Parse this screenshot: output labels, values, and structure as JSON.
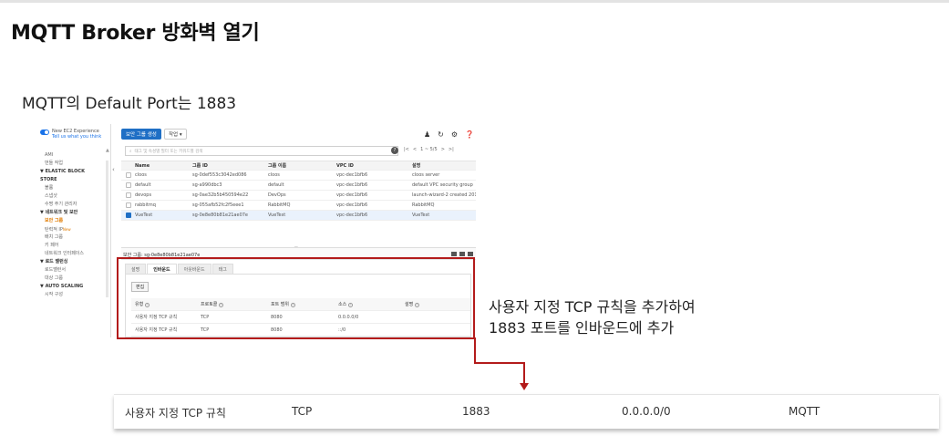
{
  "slide": {
    "title": "MQTT Broker 방화벽 열기",
    "subtitle": "MQTT의 Default Port는 1883",
    "note_line1": "사용자 지정 TCP 규칙을 추가하여",
    "note_line2": "1883 포트를 인바운드에 추가"
  },
  "console": {
    "new_experience": "New EC2 Experience",
    "tell_us": "Tell us what you think",
    "sidebar": [
      {
        "label": "AMI",
        "type": "item"
      },
      {
        "label": "번들 작업",
        "type": "item"
      },
      {
        "label": "▼ ELASTIC BLOCK",
        "type": "header"
      },
      {
        "label": "STORE",
        "type": "header"
      },
      {
        "label": "볼륨",
        "type": "item"
      },
      {
        "label": "스냅샷",
        "type": "item"
      },
      {
        "label": "수명 주기 관리자",
        "type": "item"
      },
      {
        "label": "▼ 네트워크 및 보안",
        "type": "header"
      },
      {
        "label": "보안 그룹",
        "type": "active"
      },
      {
        "label": "탄력적 IP",
        "type": "item",
        "badge": "New"
      },
      {
        "label": "배치 그룹",
        "type": "item"
      },
      {
        "label": "키 페어",
        "type": "item"
      },
      {
        "label": "네트워크 인터페이스",
        "type": "item"
      },
      {
        "label": "▼ 로드 밸런싱",
        "type": "header"
      },
      {
        "label": "로드밸런서",
        "type": "item"
      },
      {
        "label": "대상 그룹",
        "type": "item"
      },
      {
        "label": "▼ AUTO SCALING",
        "type": "header"
      },
      {
        "label": "시작 구성",
        "type": "item"
      }
    ],
    "create_button": "보안 그룹 생성",
    "actions_button": "작업 ▾",
    "search_placeholder": "태그 및 속성별 필터 또는 키워드별 검색",
    "pagination": "1 ~ 5/5",
    "columns": [
      "Name",
      "그룹 ID",
      "그룹 이름",
      "VPC ID",
      "설명"
    ],
    "rows": [
      {
        "name": "cloos",
        "group_id": "sg-0def553c3042ed086",
        "group_name": "cloos",
        "vpc": "vpc-dec1bfb6",
        "desc": "cloos server",
        "selected": false
      },
      {
        "name": "default",
        "group_id": "sg-a990dbc3",
        "group_name": "default",
        "vpc": "vpc-dec1bfb6",
        "desc": "default VPC security group",
        "selected": false
      },
      {
        "name": "devops",
        "group_id": "sg-0ae32b5b450594e22",
        "group_name": "DevOps",
        "vpc": "vpc-dec1bfb6",
        "desc": "launch-wizard-2 created 2019",
        "selected": false
      },
      {
        "name": "rabbitmq",
        "group_id": "sg-055afb52fc2f5eee1",
        "group_name": "RabbitMQ",
        "vpc": "vpc-dec1bfb6",
        "desc": "RabbitMQ",
        "selected": false
      },
      {
        "name": "VueTest",
        "group_id": "sg-0e8e80b81e21ae07e",
        "group_name": "VueTest",
        "vpc": "vpc-dec1bfb6",
        "desc": "VueTest",
        "selected": true
      }
    ],
    "detail_title": "보안 그룹: sg-0e8e80b81e21ae07e",
    "tabs": [
      "설명",
      "인바운드",
      "아웃바운드",
      "태그"
    ],
    "active_tab": "인바운드",
    "edit_button": "편집",
    "rule_columns": [
      "유형",
      "프로토콜",
      "포트 범위",
      "소스",
      "설명"
    ],
    "rules": [
      {
        "type": "사용자 지정 TCP 규칙",
        "protocol": "TCP",
        "port": "8080",
        "source": "0.0.0.0/0",
        "desc": ""
      },
      {
        "type": "사용자 지정 TCP 규칙",
        "protocol": "TCP",
        "port": "8080",
        "source": "::/0",
        "desc": ""
      }
    ]
  },
  "result_row": {
    "type": "사용자 지정 TCP 규칙",
    "protocol": "TCP",
    "port": "1883",
    "source": "0.0.0.0/0",
    "description": "MQTT"
  },
  "colors": {
    "highlight": "#b31b1b",
    "aws_blue": "#1f6fc5",
    "active_orange": "#e07b00"
  }
}
